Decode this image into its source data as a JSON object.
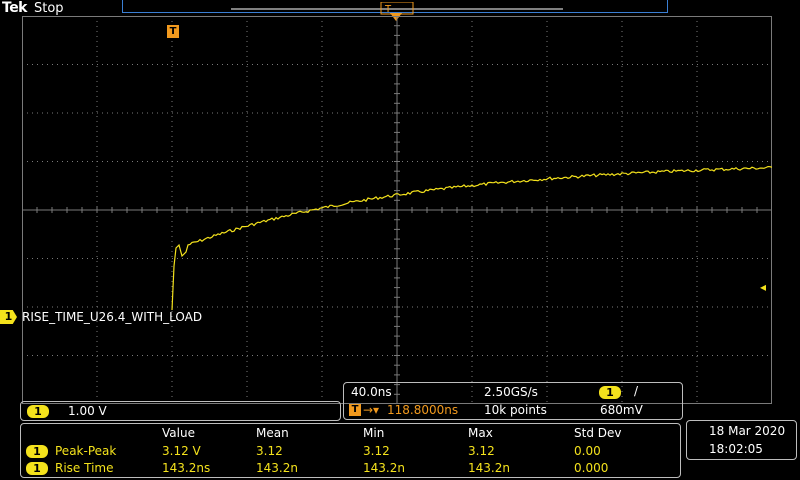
{
  "header": {
    "logo": "Tek",
    "status": "Stop"
  },
  "colors": {
    "channel1": "#f4e21c",
    "trigger": "#f29a1e",
    "grid": "#7a7a7a",
    "record_bar": "#3a7fd4"
  },
  "icons": {
    "trigger_marker": "T",
    "channel_marker": "1"
  },
  "channel": {
    "number": "1",
    "label": "RISE_TIME_U26.4_WITH_LOAD",
    "scale": "1.00 V"
  },
  "timebase": {
    "time_per_div": "40.0ns",
    "sample_rate": "2.50GS/s",
    "trigger_channel": "1",
    "trigger_slope": "/",
    "trigger_delay": "118.8000ns",
    "record_length": "10k points",
    "trigger_level": "680mV"
  },
  "measurements": {
    "headers": [
      "Value",
      "Mean",
      "Min",
      "Max",
      "Std Dev"
    ],
    "rows": [
      {
        "channel": "1",
        "name": "Peak-Peak",
        "values": [
          "3.12 V",
          "3.12",
          "3.12",
          "3.12",
          "0.00"
        ]
      },
      {
        "channel": "1",
        "name": "Rise Time",
        "values": [
          "143.2ns",
          "143.2n",
          "143.2n",
          "143.2n",
          "0.000"
        ]
      }
    ]
  },
  "datetime": {
    "date": "18 Mar  2020",
    "time": "18:02:05"
  }
}
